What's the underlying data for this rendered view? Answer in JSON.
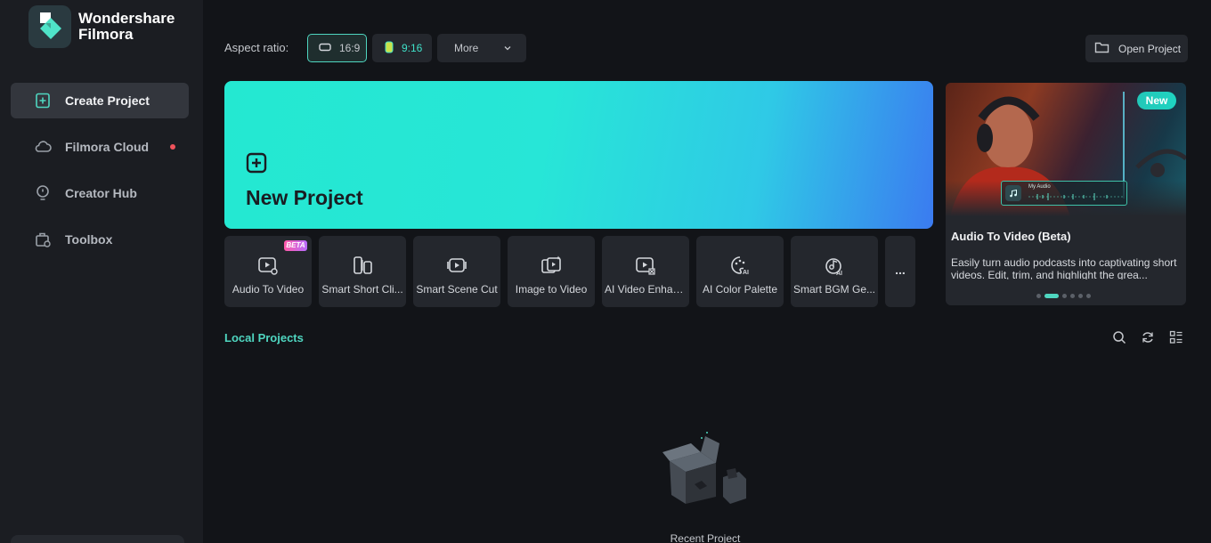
{
  "app": {
    "brand_line1": "Wondershare",
    "brand_line2": "Filmora"
  },
  "sidebar": {
    "items": [
      {
        "label": "Create Project",
        "icon": "plus-square-icon",
        "active": true
      },
      {
        "label": "Filmora Cloud",
        "icon": "cloud-icon",
        "notification": true
      },
      {
        "label": "Creator Hub",
        "icon": "bulb-icon"
      },
      {
        "label": "Toolbox",
        "icon": "toolbox-icon"
      }
    ]
  },
  "toolbar": {
    "aspect_label": "Aspect ratio:",
    "ratio_16_9": "16:9",
    "ratio_9_16": "9:16",
    "more_label": "More",
    "open_project": "Open Project"
  },
  "banner": {
    "title": "New Project",
    "colors": {
      "start": "#24e8d1",
      "end": "#3b7bf0"
    }
  },
  "tools": [
    {
      "label": "Audio To Video",
      "icon": "audio-to-video-icon",
      "badge": "BETA"
    },
    {
      "label": "Smart Short Cli...",
      "icon": "smart-short-clips-icon"
    },
    {
      "label": "Smart Scene Cut",
      "icon": "smart-scene-cut-icon"
    },
    {
      "label": "Image to Video",
      "icon": "image-to-video-icon"
    },
    {
      "label": "AI Video Enhan...",
      "icon": "ai-video-enhancer-icon"
    },
    {
      "label": "AI Color Palette",
      "icon": "ai-color-palette-icon"
    },
    {
      "label": "Smart BGM Ge...",
      "icon": "smart-bgm-icon"
    },
    {
      "label": "...",
      "icon": "more-dots-icon"
    }
  ],
  "promo": {
    "badge": "New",
    "widget_tag": "My Audio",
    "title": "Audio To Video (Beta)",
    "description": "Easily turn audio podcasts into captivating short videos. Edit, trim, and highlight the grea...",
    "slide_count": 6,
    "active_slide": 1
  },
  "local_projects": {
    "title": "Local Projects",
    "empty_label": "Recent Project"
  },
  "colors": {
    "accent": "#4fd6c0",
    "background": "#121418",
    "sidebar": "#1b1d22",
    "notification": "#f0535c"
  }
}
